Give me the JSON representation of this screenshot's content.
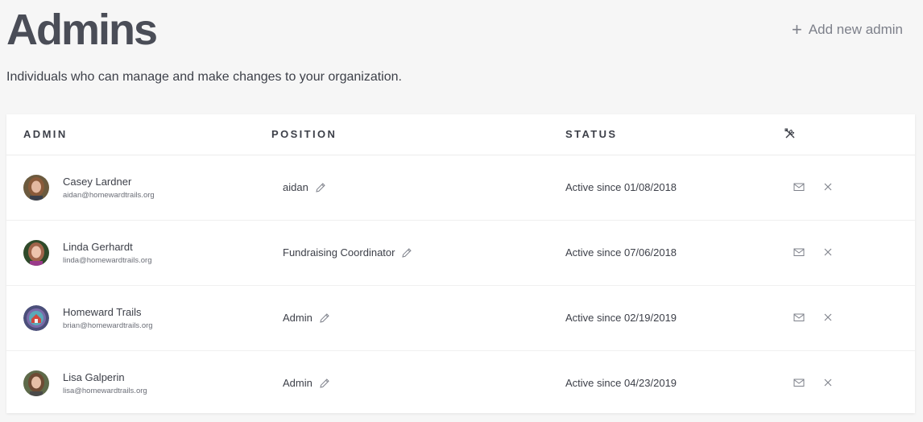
{
  "header": {
    "title": "Admins",
    "add_label": "Add new admin",
    "subtitle": "Individuals who can manage and make changes to your organization."
  },
  "table": {
    "columns": {
      "admin": "ADMIN",
      "position": "POSITION",
      "status": "STATUS"
    },
    "rows": [
      {
        "name": "Casey Lardner",
        "email": "aidan@homewardtrails.org",
        "position": "aidan",
        "status": "Active since 01/08/2018"
      },
      {
        "name": "Linda Gerhardt",
        "email": "linda@homewardtrails.org",
        "position": "Fundraising Coordinator",
        "status": "Active since 07/06/2018"
      },
      {
        "name": "Homeward Trails",
        "email": "brian@homewardtrails.org",
        "position": "Admin",
        "status": "Active since 02/19/2019"
      },
      {
        "name": "Lisa Galperin",
        "email": "lisa@homewardtrails.org",
        "position": "Admin",
        "status": "Active since 04/23/2019"
      }
    ]
  },
  "icons": {
    "add": "plus-icon",
    "tools": "tools-icon",
    "edit": "pencil-icon",
    "mail": "mail-icon",
    "remove": "close-icon"
  },
  "colors": {
    "background": "#f6f6f6",
    "card": "#ffffff",
    "title": "#4a4d57",
    "muted": "#7d808a"
  }
}
